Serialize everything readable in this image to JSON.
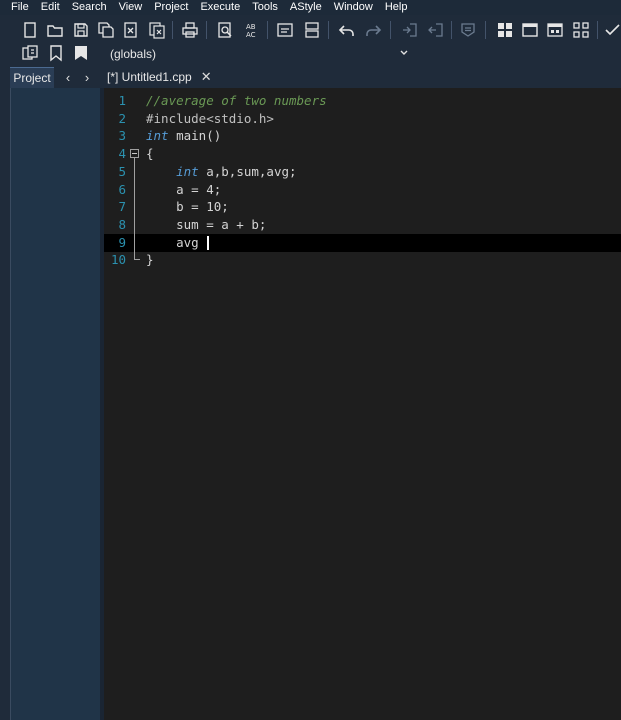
{
  "menu": [
    "File",
    "Edit",
    "Search",
    "View",
    "Project",
    "Execute",
    "Tools",
    "AStyle",
    "Window",
    "Help"
  ],
  "toolbar": {
    "icons": [
      "new-file-icon",
      "open-folder-icon",
      "save-icon",
      "save-all-icon",
      "close-file-icon",
      "close-all-icon",
      "print-icon",
      "find-icon",
      "replace-icon",
      "goto-line-icon",
      "toggle-bookmark-icon",
      "undo-icon",
      "redo-icon",
      "indent-icon",
      "unindent-icon",
      "comment-icon",
      "layout-grid-icon",
      "maximize-icon",
      "layout-icon",
      "fullscreen-icon",
      "check-icon"
    ]
  },
  "scope": {
    "value": "(globals)"
  },
  "tabs": {
    "project": "Project",
    "back": "‹",
    "forward": "›",
    "file": "[*] Untitled1.cpp",
    "close": "✕"
  },
  "code": {
    "lines": [
      {
        "n": "1",
        "parts": [
          {
            "t": "//average of two numbers",
            "c": "cmt"
          }
        ]
      },
      {
        "n": "2",
        "parts": [
          {
            "t": "#include<stdio.h>",
            "c": "pp"
          }
        ]
      },
      {
        "n": "3",
        "parts": [
          {
            "t": "int",
            "c": "kw"
          },
          {
            "t": " main()",
            "c": ""
          }
        ]
      },
      {
        "n": "4",
        "parts": [
          {
            "t": "{",
            "c": ""
          }
        ]
      },
      {
        "n": "5",
        "parts": [
          {
            "t": "    ",
            "c": ""
          },
          {
            "t": "int",
            "c": "kw"
          },
          {
            "t": " a,b,sum,avg;",
            "c": ""
          }
        ]
      },
      {
        "n": "6",
        "parts": [
          {
            "t": "    a = 4;",
            "c": ""
          }
        ]
      },
      {
        "n": "7",
        "parts": [
          {
            "t": "    b = 10;",
            "c": ""
          }
        ]
      },
      {
        "n": "8",
        "parts": [
          {
            "t": "    sum = a + b;",
            "c": ""
          }
        ]
      },
      {
        "n": "9",
        "parts": [
          {
            "t": "    avg ",
            "c": ""
          }
        ]
      },
      {
        "n": "10",
        "parts": [
          {
            "t": "}",
            "c": ""
          }
        ]
      }
    ],
    "current_line": "9"
  }
}
